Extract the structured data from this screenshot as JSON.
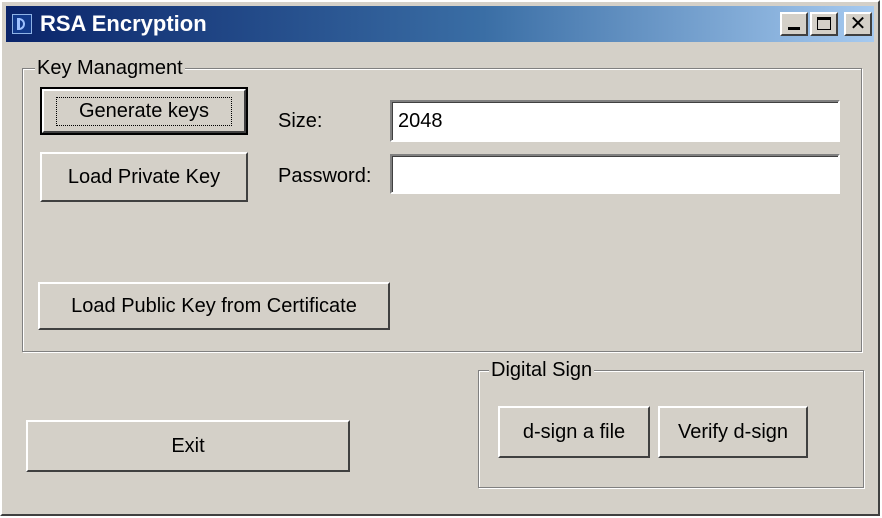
{
  "window": {
    "title": "RSA Encryption",
    "icon": "app-icon"
  },
  "titlebar_buttons": {
    "minimize": "minimize-icon",
    "maximize": "maximize-icon",
    "close": "✕"
  },
  "key_management": {
    "group_label": "Key Managment",
    "generate_label": "Generate keys",
    "load_private_label": "Load Private Key",
    "load_public_label": "Load Public Key from Certificate",
    "size_label": "Size:",
    "size_value": "2048",
    "password_label": "Password:",
    "password_value": ""
  },
  "digital_sign": {
    "group_label": "Digital Sign",
    "dsign_label": "d-sign a file",
    "verify_label": "Verify d-sign"
  },
  "exit_label": "Exit"
}
